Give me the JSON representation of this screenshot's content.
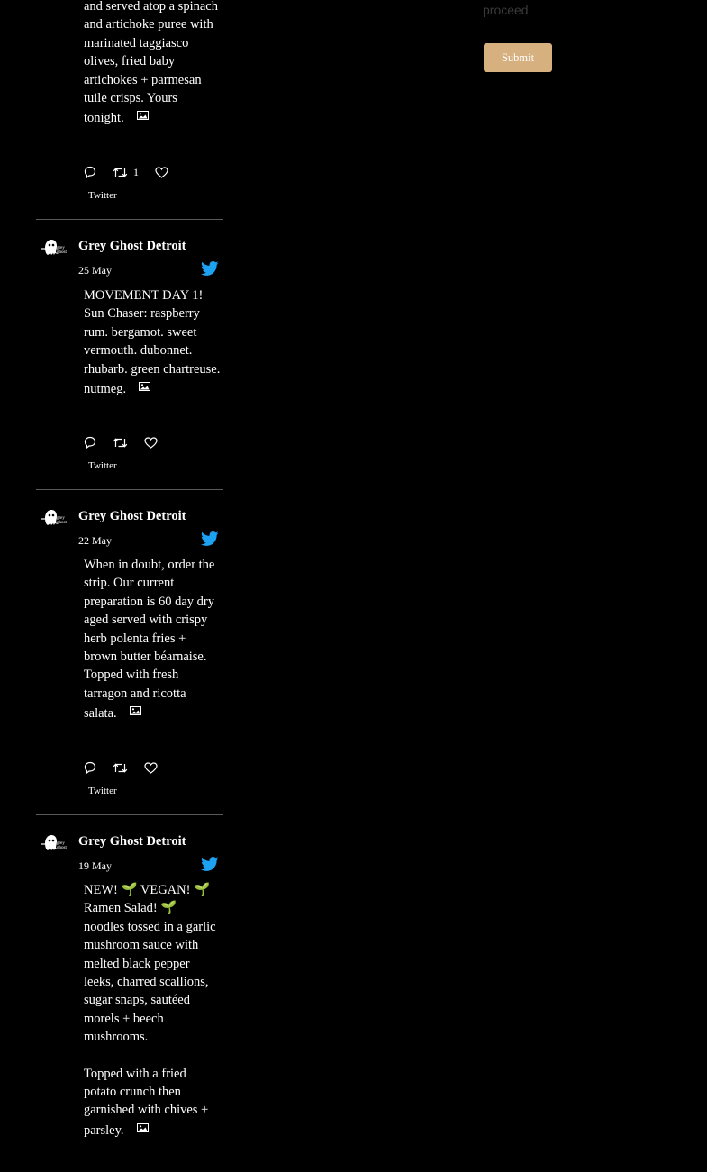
{
  "form": {
    "proceed_text": "proceed.",
    "submit_label": "Submit"
  },
  "colors": {
    "background": "#000000",
    "submit_button": "#d6b07f",
    "twitter_blue": "#1da1f2",
    "divider": "#5a5a5a"
  },
  "tweets": [
    {
      "body": [
        "and served atop a spinach and artichoke puree with marinated taggiasco olives, fried baby artichokes + parmesan tuile crisps. Yours tonight."
      ],
      "retweet_count": "1",
      "source": "Twitter"
    },
    {
      "author": "Grey Ghost Detroit",
      "date": "25 May",
      "body": [
        "MOVEMENT DAY 1! Sun Chaser: raspberry rum. bergamot. sweet vermouth. dubonnet. rhubarb. green chartreuse. nutmeg."
      ],
      "source": "Twitter"
    },
    {
      "author": "Grey Ghost Detroit",
      "date": "22 May",
      "body": [
        "When in doubt, order the strip. Our current preparation is 60 day dry aged served with crispy herb polenta fries + brown butter béarnaise. Topped with fresh tarragon and ricotta salata."
      ],
      "source": "Twitter"
    },
    {
      "author": "Grey Ghost Detroit",
      "date": "19 May",
      "body": [
        "NEW! 🌱 VEGAN! 🌱 Ramen Salad! 🌱 noodles tossed in a garlic mushroom sauce with melted black pepper leeks, charred scallions, sugar snaps, sautéed morels + beech mushrooms.",
        "Topped with a fried potato crunch then garnished with chives + parsley."
      ]
    }
  ],
  "icons": {
    "reply": "reply-icon",
    "retweet": "retweet-icon",
    "like": "like-icon",
    "twitter": "twitter-bird-icon",
    "photo": "photo-icon",
    "avatar": "grey-ghost-avatar"
  }
}
